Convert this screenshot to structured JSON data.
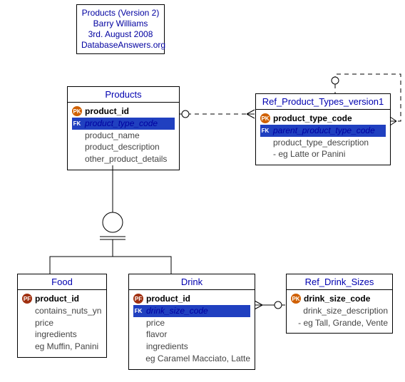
{
  "info": {
    "line1": "Products (Version 2)",
    "line2": "Barry Williams",
    "line3": "3rd. August 2008",
    "line4": "DatabaseAnswers.org"
  },
  "entities": {
    "products": {
      "title": "Products",
      "fields": [
        {
          "key": "pk",
          "name": "product_id",
          "bold": true
        },
        {
          "key": "fk",
          "name": "product_type_code",
          "italic": true
        },
        {
          "key": "",
          "name": "product_name"
        },
        {
          "key": "",
          "name": "product_description"
        },
        {
          "key": "",
          "name": "other_product_details"
        }
      ]
    },
    "ref_product_types": {
      "title": "Ref_Product_Types_version1",
      "fields": [
        {
          "key": "pk",
          "name": "product_type_code",
          "bold": true
        },
        {
          "key": "fk",
          "name": "parent_product_type_code",
          "italic": true
        },
        {
          "key": "",
          "name": "product_type_description"
        },
        {
          "key": "",
          "name": "- eg Latte or Panini"
        }
      ]
    },
    "food": {
      "title": "Food",
      "fields": [
        {
          "key": "pf",
          "name": "product_id",
          "bold": true
        },
        {
          "key": "",
          "name": "contains_nuts_yn"
        },
        {
          "key": "",
          "name": "price"
        },
        {
          "key": "",
          "name": "ingredients"
        },
        {
          "key": "",
          "name": "eg Muffin, Panini"
        }
      ]
    },
    "drink": {
      "title": "Drink",
      "fields": [
        {
          "key": "pf",
          "name": "product_id",
          "bold": true
        },
        {
          "key": "fk",
          "name": "drink_size_code",
          "italic": true
        },
        {
          "key": "",
          "name": "price"
        },
        {
          "key": "",
          "name": "flavor"
        },
        {
          "key": "",
          "name": "ingredients"
        },
        {
          "key": "",
          "name": "eg Caramel Macciato, Latte"
        }
      ]
    },
    "ref_drink_sizes": {
      "title": "Ref_Drink_Sizes",
      "fields": [
        {
          "key": "pk",
          "name": "drink_size_code",
          "bold": true
        },
        {
          "key": "",
          "name": "drink_size_description"
        },
        {
          "key": "",
          "name": "- eg Tall, Grande, Vente"
        }
      ]
    }
  },
  "keylabels": {
    "pk": "PK",
    "fk": "FK",
    "pf": "PF"
  }
}
